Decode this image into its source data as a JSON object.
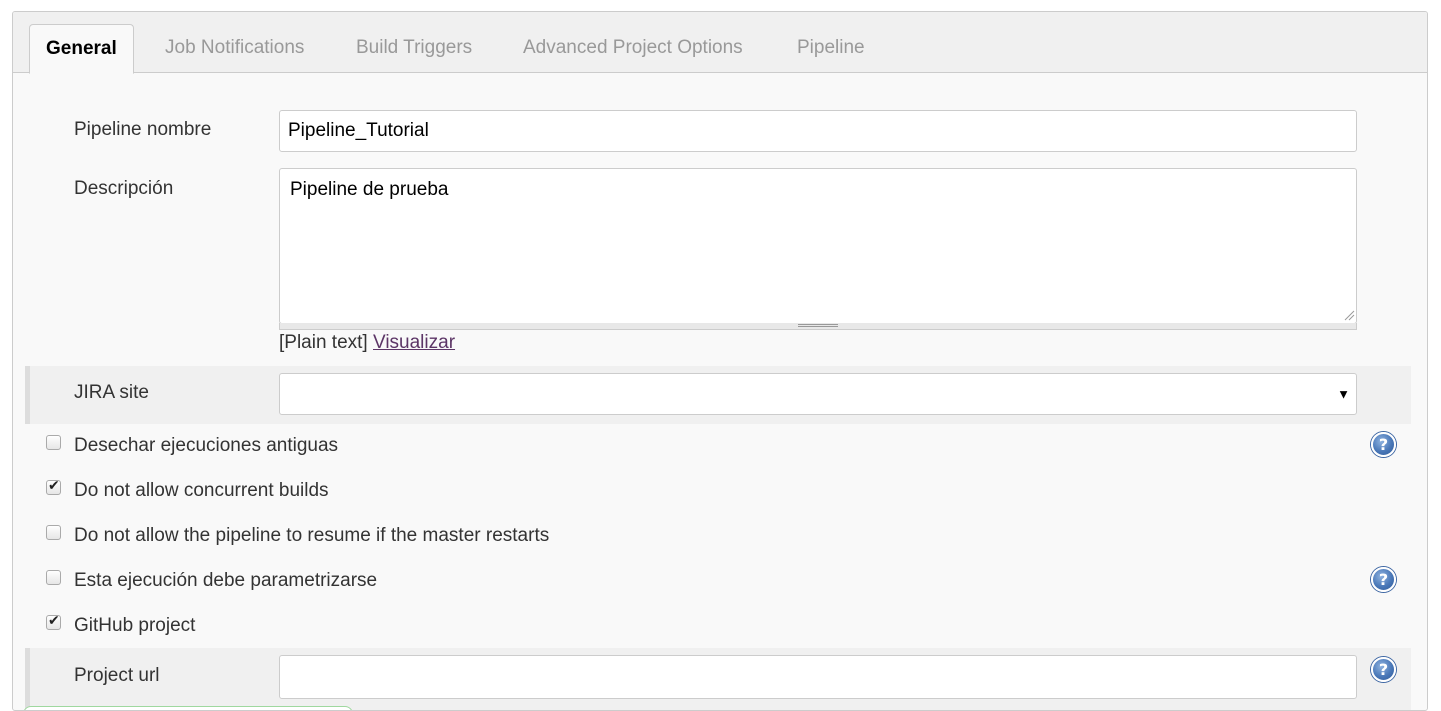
{
  "tabs": [
    {
      "label": "General",
      "active": true
    },
    {
      "label": "Job Notifications",
      "active": false
    },
    {
      "label": "Build Triggers",
      "active": false
    },
    {
      "label": "Advanced Project Options",
      "active": false
    },
    {
      "label": "Pipeline",
      "active": false
    }
  ],
  "form": {
    "name_label": "Pipeline nombre",
    "name_value": "Pipeline_Tutorial",
    "description_label": "Descripción",
    "description_value": "Pipeline de prueba",
    "format_prefix": "[Plain text]",
    "format_link": "Visualizar",
    "jira_label": "JIRA site",
    "jira_value": "",
    "project_url_label": "Project url",
    "project_url_value": ""
  },
  "options": [
    {
      "label": "Desechar ejecuciones antiguas",
      "checked": false,
      "help": true
    },
    {
      "label": "Do not allow concurrent builds",
      "checked": true,
      "help": false
    },
    {
      "label": "Do not allow the pipeline to resume if the master restarts",
      "checked": false,
      "help": false
    },
    {
      "label": "Esta ejecución debe parametrizarse",
      "checked": false,
      "help": true
    },
    {
      "label": "GitHub project",
      "checked": true,
      "help": false
    }
  ],
  "icons": {
    "help": "help-icon",
    "dropdown": "chevron-down-icon",
    "checkmark": "checkmark-icon"
  },
  "colors": {
    "link": "#5c3566",
    "help_icon": "#4a78b8",
    "panel_bg": "#f9f9f9",
    "tab_bg": "#f0f0f0"
  }
}
